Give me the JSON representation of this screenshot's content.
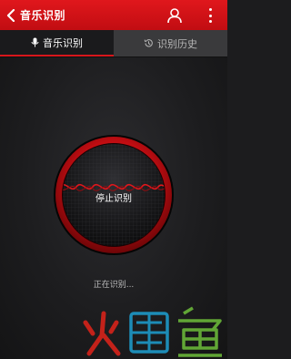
{
  "header": {
    "title": "音乐识别",
    "back_icon": "chevron-left-icon",
    "user_icon": "user-icon",
    "more_icon": "more-vertical-icon",
    "bar_color": "#d7161b"
  },
  "tabs": [
    {
      "label": "音乐识别",
      "icon": "microphone-icon",
      "active": true
    },
    {
      "label": "识别历史",
      "icon": "history-icon",
      "active": false
    }
  ],
  "recognizer": {
    "button_label": "停止识别",
    "ring_color": "#d7161b",
    "wave_color": "#e0171c"
  },
  "status": "正在识别...",
  "watermark": {
    "text": "火鲤鱼",
    "colors": [
      "#e2231a",
      "#1ea0d2",
      "#6fbf3b"
    ]
  }
}
